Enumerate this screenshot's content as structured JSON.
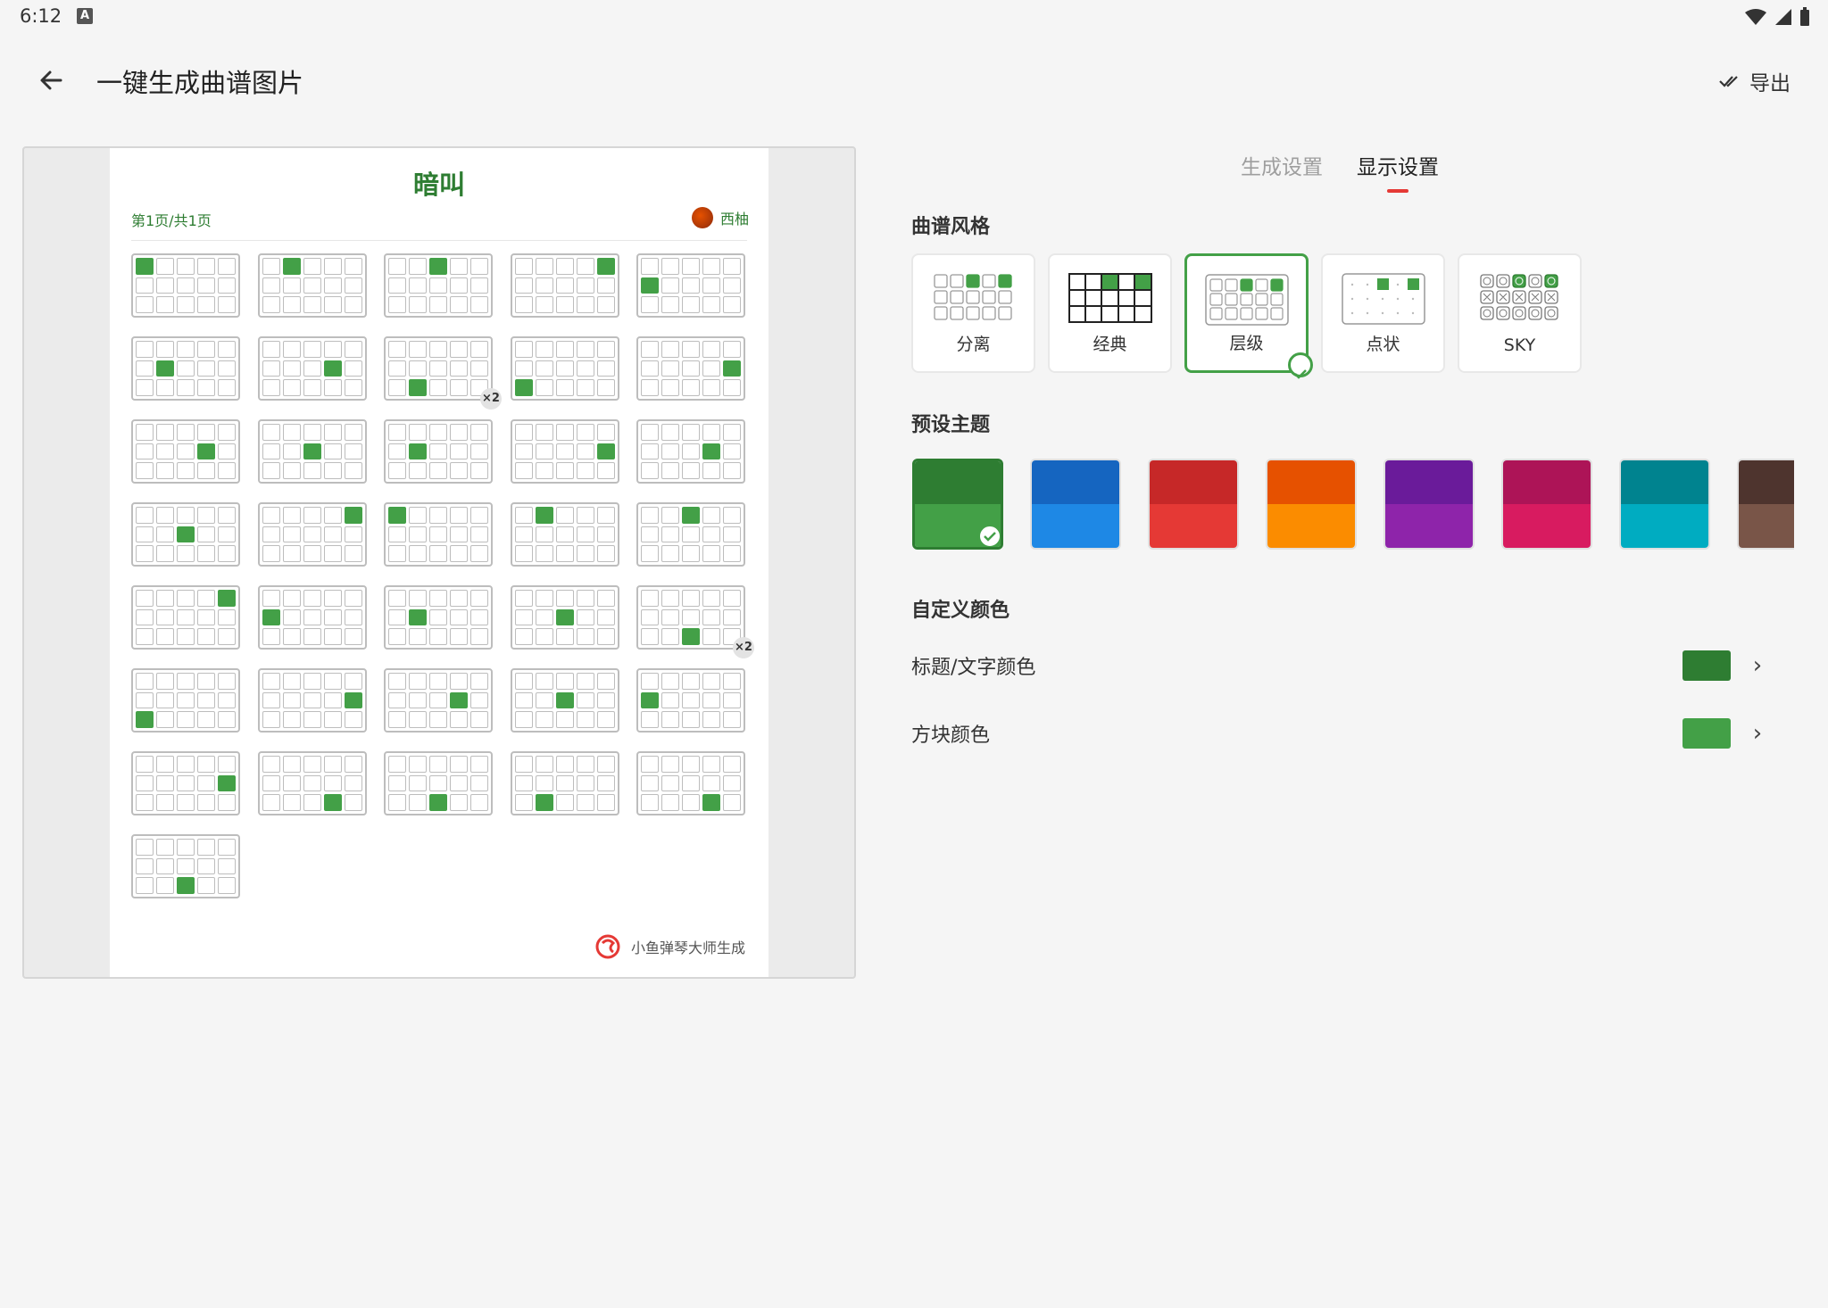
{
  "status": {
    "time": "6:12",
    "notif": "A"
  },
  "appbar": {
    "title": "一键生成曲谱图片",
    "export_label": "导出"
  },
  "preview": {
    "song_title": "暗叫",
    "page_info": "第1页/共1页",
    "author": "西柚",
    "repeat_label": "×2",
    "brand": "小鱼弹琴大师生成"
  },
  "tabs": [
    {
      "label": "生成设置",
      "active": false
    },
    {
      "label": "显示设置",
      "active": true
    }
  ],
  "sections": {
    "style": "曲谱风格",
    "theme": "预设主题",
    "custom": "自定义颜色"
  },
  "styles": [
    {
      "label": "分离",
      "selected": false
    },
    {
      "label": "经典",
      "selected": false
    },
    {
      "label": "层级",
      "selected": true
    },
    {
      "label": "点状",
      "selected": false
    },
    {
      "label": "SKY",
      "selected": false
    }
  ],
  "themes": [
    {
      "top": "#2e7d32",
      "bottom": "#43a047",
      "selected": true
    },
    {
      "top": "#1565c0",
      "bottom": "#1e88e5",
      "selected": false
    },
    {
      "top": "#c62828",
      "bottom": "#e53935",
      "selected": false
    },
    {
      "top": "#e65100",
      "bottom": "#fb8c00",
      "selected": false
    },
    {
      "top": "#6a1b9a",
      "bottom": "#8e24aa",
      "selected": false
    },
    {
      "top": "#ad1457",
      "bottom": "#d81b60",
      "selected": false
    },
    {
      "top": "#00838f",
      "bottom": "#00acc1",
      "selected": false
    },
    {
      "top": "#4e342e",
      "bottom": "#795548",
      "selected": false
    }
  ],
  "custom_colors": [
    {
      "label": "标题/文字颜色",
      "color": "#2e7d32"
    },
    {
      "label": "方块颜色",
      "color": "#43a047"
    }
  ],
  "score_cells": [
    [
      0,
      0
    ],
    [
      0,
      1
    ],
    [
      0,
      2
    ],
    [
      0,
      4
    ],
    [
      1,
      0
    ],
    [
      1,
      1
    ],
    [
      1,
      3
    ],
    [
      2,
      1
    ],
    [
      2,
      0
    ],
    [
      1,
      4
    ],
    [
      1,
      3
    ],
    [
      1,
      2
    ],
    [
      1,
      1
    ],
    [
      1,
      4
    ],
    [
      1,
      3
    ],
    [
      1,
      2
    ],
    [
      0,
      4
    ],
    [
      0,
      0
    ],
    [
      0,
      1
    ],
    [
      0,
      2
    ],
    [
      0,
      4
    ],
    [
      1,
      0
    ],
    [
      1,
      1
    ],
    [
      1,
      2
    ],
    [
      2,
      2
    ],
    [
      2,
      0
    ],
    [
      1,
      4
    ],
    [
      1,
      3
    ],
    [
      1,
      2
    ],
    [
      1,
      0
    ],
    [
      1,
      4
    ],
    [
      2,
      3
    ],
    [
      2,
      2
    ],
    [
      2,
      1
    ],
    [
      2,
      3
    ],
    [
      2,
      2
    ]
  ],
  "repeat_cells": [
    7,
    24
  ]
}
